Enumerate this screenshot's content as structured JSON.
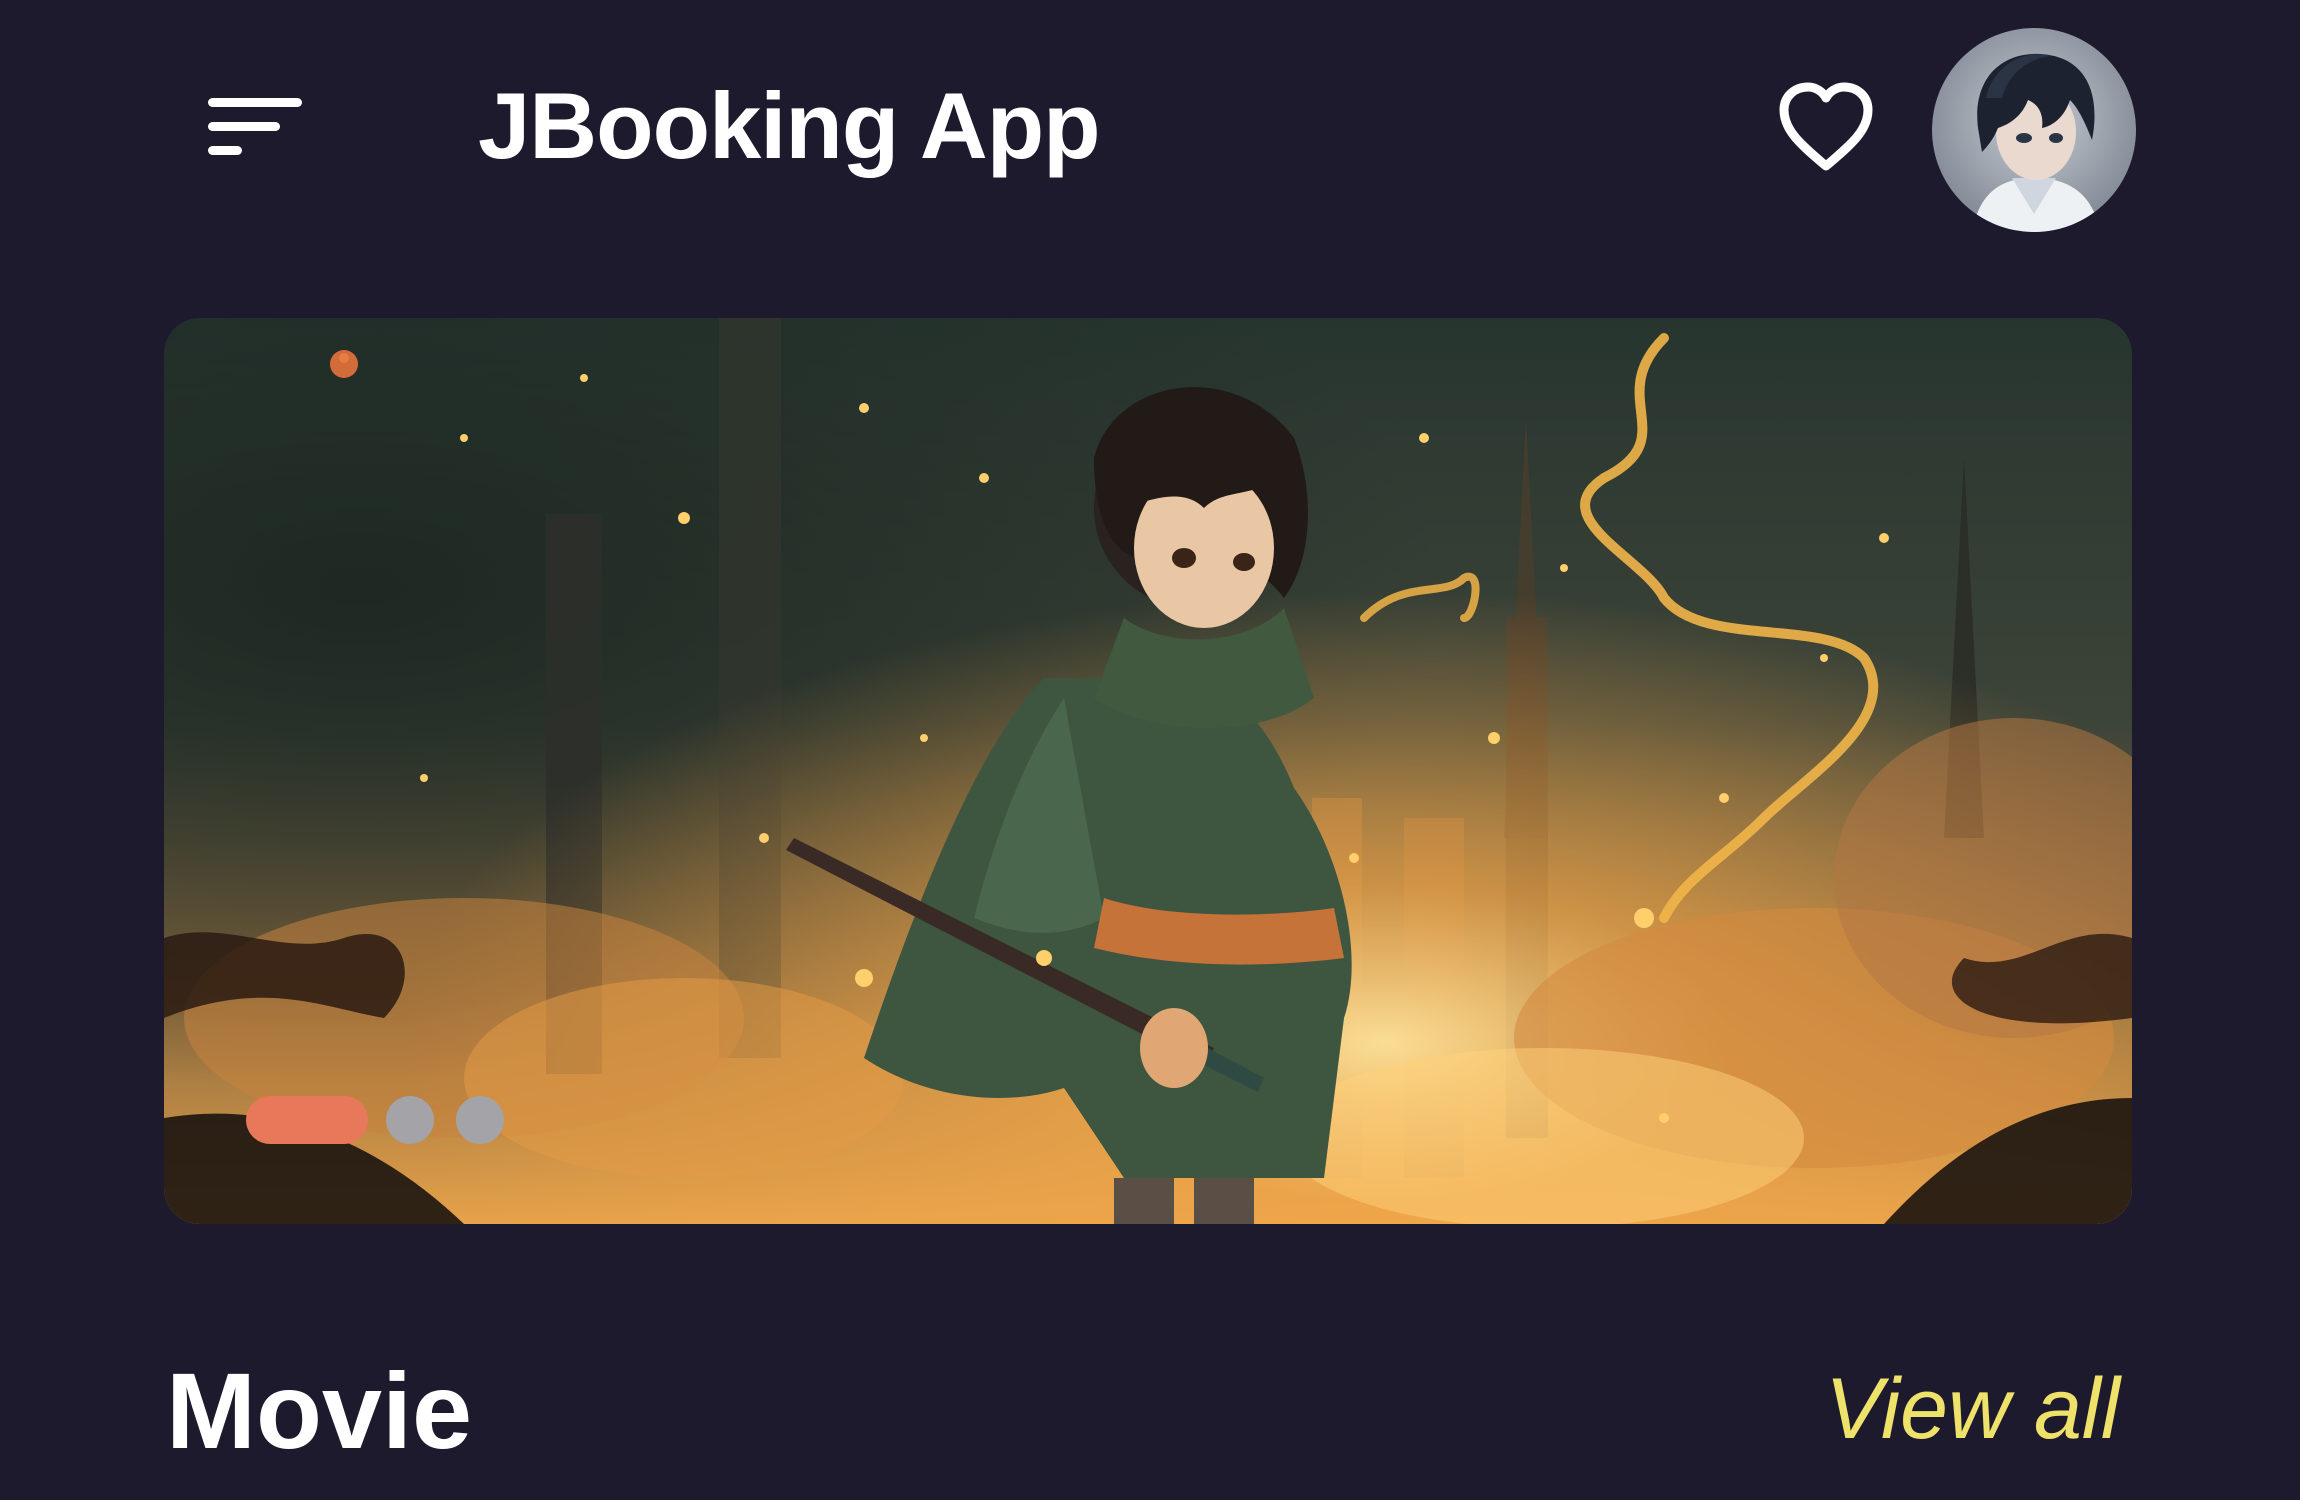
{
  "header": {
    "title": "JBooking App",
    "menu_icon": "sort-menu-icon",
    "favorite_icon": "heart-outline-icon",
    "avatar_icon": "user-avatar"
  },
  "banner": {
    "slide_count": 3,
    "active_slide": 1
  },
  "section": {
    "title": "Movie",
    "view_all_label": "View all"
  },
  "colors": {
    "background": "#1d1a2e",
    "accent_dot": "#e8785a",
    "inactive_dot": "#a3a3a8",
    "view_all": "#efe26a",
    "text": "#ffffff"
  }
}
